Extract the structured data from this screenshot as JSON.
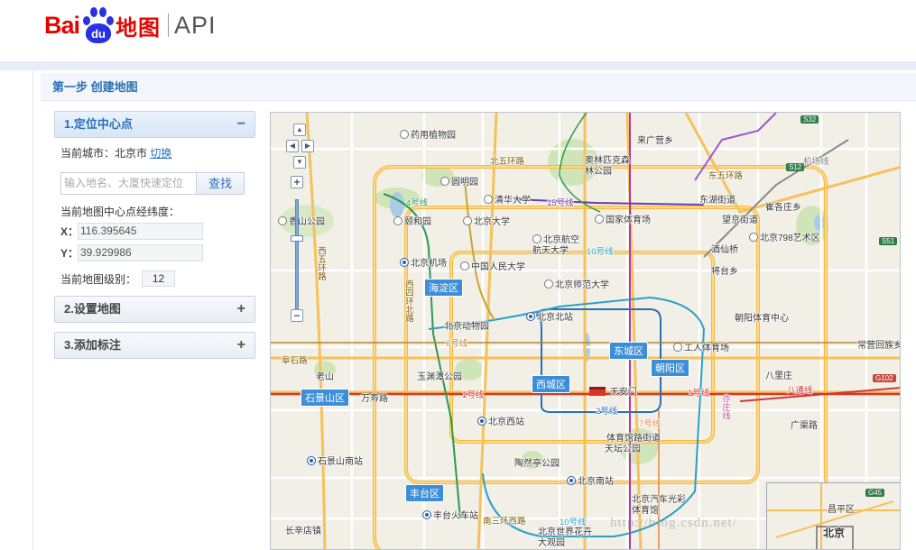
{
  "brand": {
    "logo_bai": "Bai",
    "logo_du": "du",
    "logo_map": "地图",
    "api": "API"
  },
  "step_title": "第一步 创建地图",
  "sections": [
    {
      "label": "1.定位中心点",
      "toggle": "−",
      "expanded": true
    },
    {
      "label": "2.设置地图",
      "toggle": "+",
      "expanded": false
    },
    {
      "label": "3.添加标注",
      "toggle": "+",
      "expanded": false
    }
  ],
  "locate": {
    "current_city_label": "当前城市：北京市",
    "switch_link": "切换",
    "search_placeholder": "输入地名、大厦快速定位",
    "search_button": "查找",
    "center_label": "当前地图中心点经纬度：",
    "x_label": "X：",
    "x_value": "116.395645",
    "y_label": "Y：",
    "y_value": "39.929986",
    "level_label": "当前地图级别：",
    "level_value": "12"
  },
  "map": {
    "nav_buttons": {
      "up": "▲",
      "left": "◀",
      "right": "▶",
      "down": "▼",
      "zoom_in": "+",
      "zoom_out": "−"
    },
    "zoom_level": 12,
    "districts": [
      "海淀区",
      "西城区",
      "东城区",
      "朝阳区",
      "石景山区",
      "丰台区"
    ],
    "pois": [
      "药用植物园",
      "圆明园",
      "清华大学",
      "奥林匹克森林公园",
      "颐和园",
      "北京大学",
      "国家体育场",
      "北京航空航天大学",
      "北京机场",
      "中国人民大学",
      "北京师范大学",
      "北京动物园",
      "北京北站",
      "玉渊潭公园",
      "北京西站",
      "天坛公园",
      "陶然亭公园",
      "北京南站",
      "石景山南站",
      "丰台火车站",
      "北京汽车光彩体育馆",
      "北京世界花卉大观园",
      "工人体育场",
      "朝阳体育中心",
      "北京798艺术区",
      "来广营乡",
      "东湖街道",
      "望京街道",
      "崔各庄乡",
      "酒仙桥",
      "将台乡",
      "常营回族乡",
      "广渠路",
      "体育馆路街道",
      "万寿路",
      "长辛店镇",
      "八里庄",
      "香山公园",
      "老山",
      "阜石路",
      "北五环路",
      "南三环西路",
      "东五环路",
      "西四环北路",
      "西五环路",
      "机场线",
      "亦庄线"
    ],
    "metro_lines": [
      "1号线",
      "2号线",
      "4号线",
      "5号线",
      "6号线",
      "7号线",
      "10号线",
      "13号线",
      "15号线",
      "八通线",
      "亦庄线",
      "机场线"
    ],
    "highway_shields": [
      "S32",
      "S12",
      "S51",
      "G102",
      "G45"
    ],
    "overview_label": "北京",
    "overview_sub": "昌平区",
    "watermark": "http://blog.csdn.net/"
  }
}
